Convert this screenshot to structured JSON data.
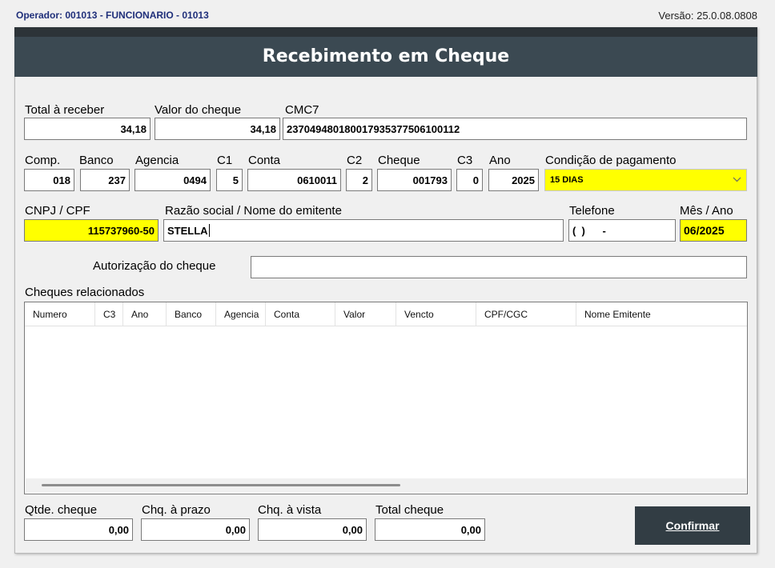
{
  "header": {
    "operator": "Operador: 001013 - FUNCIONARIO - 01013",
    "version": "Versão: 25.0.08.0808"
  },
  "window": {
    "title": "Recebimento em Cheque"
  },
  "row1": {
    "total_label": "Total à receber",
    "total_value": "34,18",
    "valor_label": "Valor do cheque",
    "valor_value": "34,18",
    "cmc7_label": "CMC7",
    "cmc7_value": "237049480180017935377506100112"
  },
  "row2": {
    "comp_label": "Comp.",
    "comp_value": "018",
    "banco_label": "Banco",
    "banco_value": "237",
    "agencia_label": "Agencia",
    "agencia_value": "0494",
    "c1_label": "C1",
    "c1_value": "5",
    "conta_label": "Conta",
    "conta_value": "0610011",
    "c2_label": "C2",
    "c2_value": "2",
    "cheque_label": "Cheque",
    "cheque_value": "001793",
    "c3_label": "C3",
    "c3_value": "0",
    "ano_label": "Ano",
    "ano_value": "2025",
    "condicao_label": "Condição de pagamento",
    "condicao_value": "15 DIAS"
  },
  "row3": {
    "cnpj_label": "CNPJ / CPF",
    "cnpj_value": "115737960-50",
    "razao_label": "Razão social / Nome do emitente",
    "razao_value": "STELLA",
    "telefone_label": "Telefone",
    "telefone_value": "(  )      -",
    "mesano_label": "Mês / Ano",
    "mesano_value": "06/2025"
  },
  "autorizacao": {
    "label": "Autorização do cheque",
    "value": ""
  },
  "grid": {
    "title": "Cheques relacionados",
    "columns": [
      "Numero",
      "C3",
      "Ano",
      "Banco",
      "Agencia",
      "Conta",
      "Valor",
      "Vencto",
      "CPF/CGC",
      "Nome Emitente"
    ]
  },
  "footer": {
    "qtde_label": "Qtde. cheque",
    "qtde_value": "0,00",
    "prazo_label": "Chq. à prazo",
    "prazo_value": "0,00",
    "vista_label": "Chq. à vista",
    "vista_value": "0,00",
    "total_label": "Total cheque",
    "total_value": "0,00",
    "confirm_label": "Confirmar"
  },
  "colors": {
    "titlebar": "#3b4952",
    "highlight": "#ffff00",
    "button": "#323d44",
    "operator_text": "#1f2f7a"
  },
  "icons": {
    "dropdown": "chevron-down-icon"
  }
}
